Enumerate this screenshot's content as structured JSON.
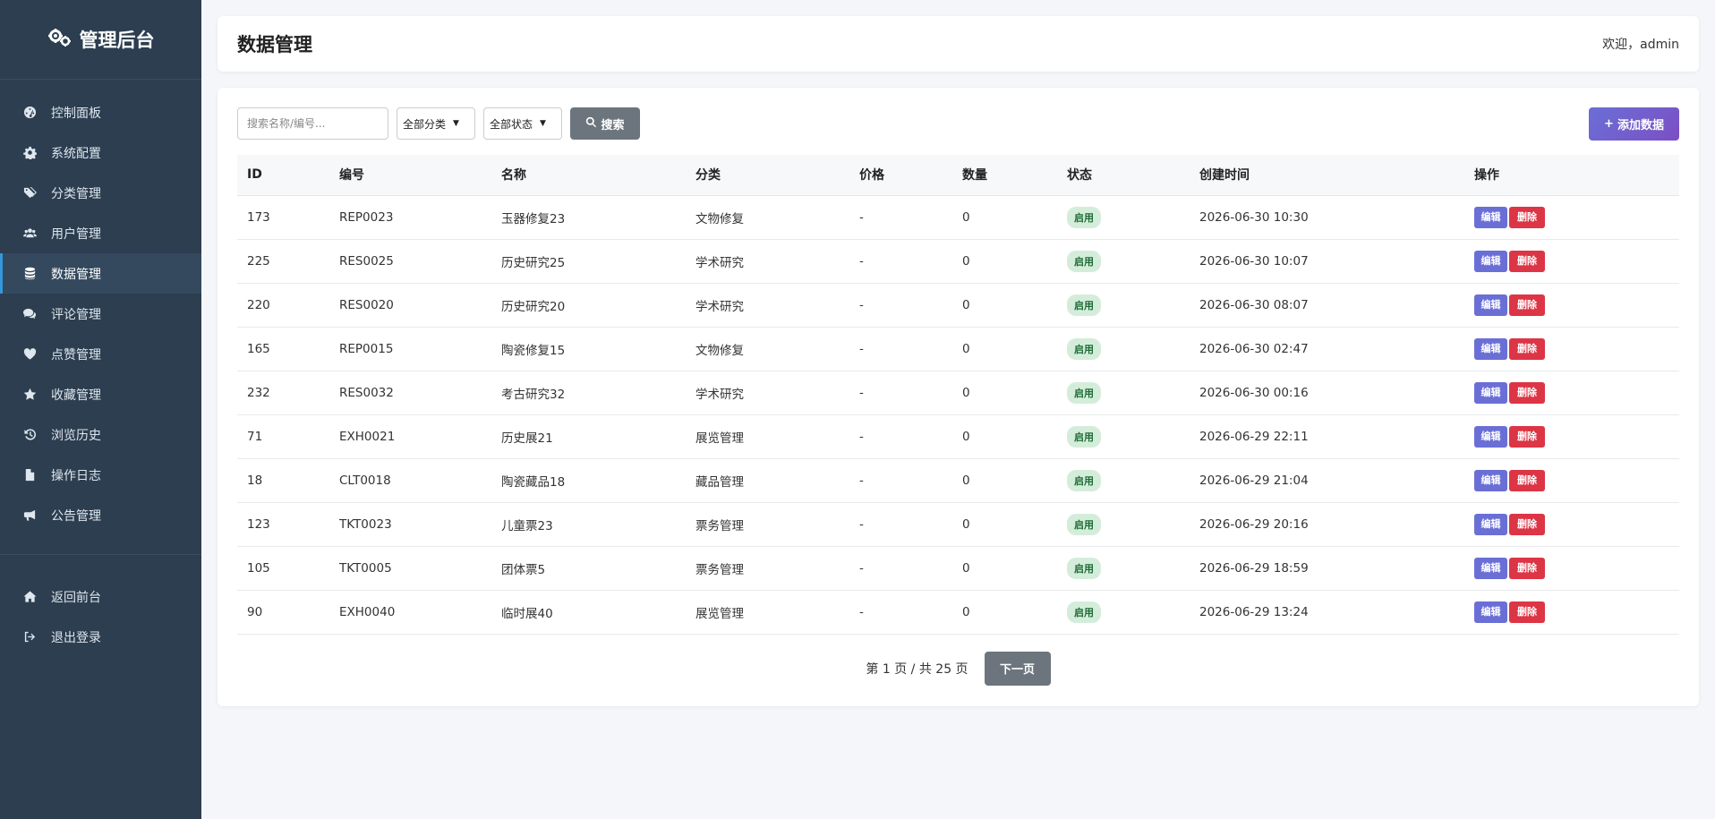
{
  "sidebar": {
    "brand": "管理后台",
    "brand_icon": "gears-icon",
    "items": [
      {
        "label": "控制面板",
        "icon": "dashboard-icon",
        "active": false
      },
      {
        "label": "系统配置",
        "icon": "gear-icon",
        "active": false
      },
      {
        "label": "分类管理",
        "icon": "tags-icon",
        "active": false
      },
      {
        "label": "用户管理",
        "icon": "users-icon",
        "active": false
      },
      {
        "label": "数据管理",
        "icon": "database-icon",
        "active": true
      },
      {
        "label": "评论管理",
        "icon": "comments-icon",
        "active": false
      },
      {
        "label": "点赞管理",
        "icon": "heart-icon",
        "active": false
      },
      {
        "label": "收藏管理",
        "icon": "star-icon",
        "active": false
      },
      {
        "label": "浏览历史",
        "icon": "history-icon",
        "active": false
      },
      {
        "label": "操作日志",
        "icon": "file-icon",
        "active": false
      },
      {
        "label": "公告管理",
        "icon": "bullhorn-icon",
        "active": false
      }
    ],
    "bottom_items": [
      {
        "label": "返回前台",
        "icon": "home-icon"
      },
      {
        "label": "退出登录",
        "icon": "sign-out-icon"
      }
    ]
  },
  "header": {
    "title": "数据管理",
    "welcome": "欢迎，admin"
  },
  "toolbar": {
    "search_placeholder": "搜索名称/编号...",
    "category_select": "全部分类",
    "status_select": "全部状态",
    "search_label": "搜索",
    "add_label": "添加数据"
  },
  "table": {
    "columns": [
      "ID",
      "编号",
      "名称",
      "分类",
      "价格",
      "数量",
      "状态",
      "创建时间",
      "操作"
    ],
    "rows": [
      {
        "id": "173",
        "code": "REP0023",
        "name": "玉器修复23",
        "category": "文物修复",
        "price": "-",
        "qty": "0",
        "status": "启用",
        "created": "2026-06-30 10:30"
      },
      {
        "id": "225",
        "code": "RES0025",
        "name": "历史研究25",
        "category": "学术研究",
        "price": "-",
        "qty": "0",
        "status": "启用",
        "created": "2026-06-30 10:07"
      },
      {
        "id": "220",
        "code": "RES0020",
        "name": "历史研究20",
        "category": "学术研究",
        "price": "-",
        "qty": "0",
        "status": "启用",
        "created": "2026-06-30 08:07"
      },
      {
        "id": "165",
        "code": "REP0015",
        "name": "陶瓷修复15",
        "category": "文物修复",
        "price": "-",
        "qty": "0",
        "status": "启用",
        "created": "2026-06-30 02:47"
      },
      {
        "id": "232",
        "code": "RES0032",
        "name": "考古研究32",
        "category": "学术研究",
        "price": "-",
        "qty": "0",
        "status": "启用",
        "created": "2026-06-30 00:16"
      },
      {
        "id": "71",
        "code": "EXH0021",
        "name": "历史展21",
        "category": "展览管理",
        "price": "-",
        "qty": "0",
        "status": "启用",
        "created": "2026-06-29 22:11"
      },
      {
        "id": "18",
        "code": "CLT0018",
        "name": "陶瓷藏品18",
        "category": "藏品管理",
        "price": "-",
        "qty": "0",
        "status": "启用",
        "created": "2026-06-29 21:04"
      },
      {
        "id": "123",
        "code": "TKT0023",
        "name": "儿童票23",
        "category": "票务管理",
        "price": "-",
        "qty": "0",
        "status": "启用",
        "created": "2026-06-29 20:16"
      },
      {
        "id": "105",
        "code": "TKT0005",
        "name": "团体票5",
        "category": "票务管理",
        "price": "-",
        "qty": "0",
        "status": "启用",
        "created": "2026-06-29 18:59"
      },
      {
        "id": "90",
        "code": "EXH0040",
        "name": "临时展40",
        "category": "展览管理",
        "price": "-",
        "qty": "0",
        "status": "启用",
        "created": "2026-06-29 13:24"
      }
    ],
    "edit_label": "编辑",
    "delete_label": "删除"
  },
  "pagination": {
    "info": "第 1 页 / 共 25 页",
    "next_label": "下一页"
  },
  "colors": {
    "sidebar_bg": "#2c3e50",
    "accent": "#6a6fd6",
    "danger": "#dc3545",
    "success_badge": "#d4edda"
  }
}
